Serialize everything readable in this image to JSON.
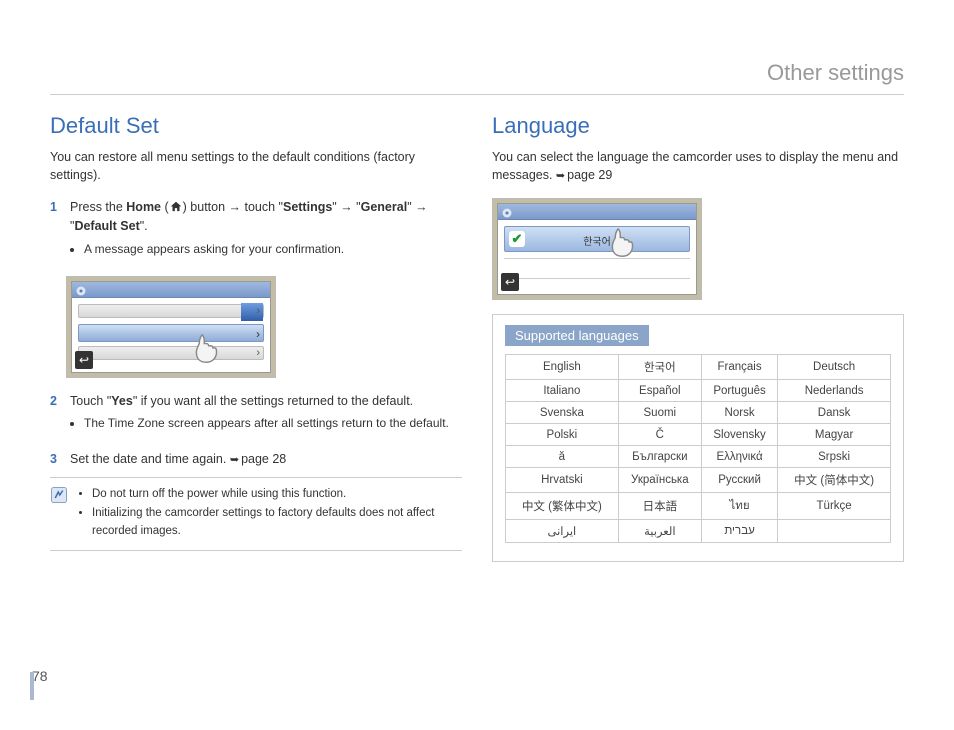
{
  "header": {
    "title": "Other settings"
  },
  "page_number": "78",
  "left": {
    "heading": "Default Set",
    "intro": "You can restore all menu settings to the default conditions (factory settings).",
    "step1_prefix": "Press the ",
    "step1_home": "Home",
    "step1_mid1": " ( ",
    "step1_mid2": " ) button → touch \"",
    "step1_settings": "Settings",
    "step1_mid3": "\" → \"",
    "step1_general": "General",
    "step1_mid4": "\" → \"",
    "step1_default": "Default Set",
    "step1_end": "\".",
    "step1_bullet": "A message appears asking for your confirmation.",
    "step2_prefix": "Touch \"",
    "step2_yes": "Yes",
    "step2_suffix": "\" if you want all the settings returned to the default.",
    "step2_bullet": "The Time Zone screen appears after all settings return to the default.",
    "step3_text": "Set the date and time again. ",
    "step3_ref": "page 28",
    "note1": "Do not turn off the power while using this function.",
    "note2": "Initializing the camcorder settings to factory defaults does not affect recorded images."
  },
  "right": {
    "heading": "Language",
    "intro_a": "You can select the language the camcorder uses to display the menu and messages. ",
    "intro_ref": "page 29",
    "selected_lang": "한국어",
    "sup_header": "Supported languages",
    "langs": [
      [
        "English",
        "한국어",
        "Français",
        "Deutsch"
      ],
      [
        "Italiano",
        "Español",
        "Português",
        "Nederlands"
      ],
      [
        "Svenska",
        "Suomi",
        "Norsk",
        "Dansk"
      ],
      [
        "Polski",
        "Č",
        "Slovensky",
        "Magyar"
      ],
      [
        "ă",
        "Български",
        "Ελληνικά",
        "Srpski"
      ],
      [
        "Hrvatski",
        "Українська",
        "Русский",
        "中文 (简体中文)"
      ],
      [
        "中文 (繁体中文)",
        "日本語",
        "ไทย",
        "Türkçe"
      ],
      [
        "ایرانی",
        "العربية",
        "עברית",
        ""
      ]
    ]
  }
}
